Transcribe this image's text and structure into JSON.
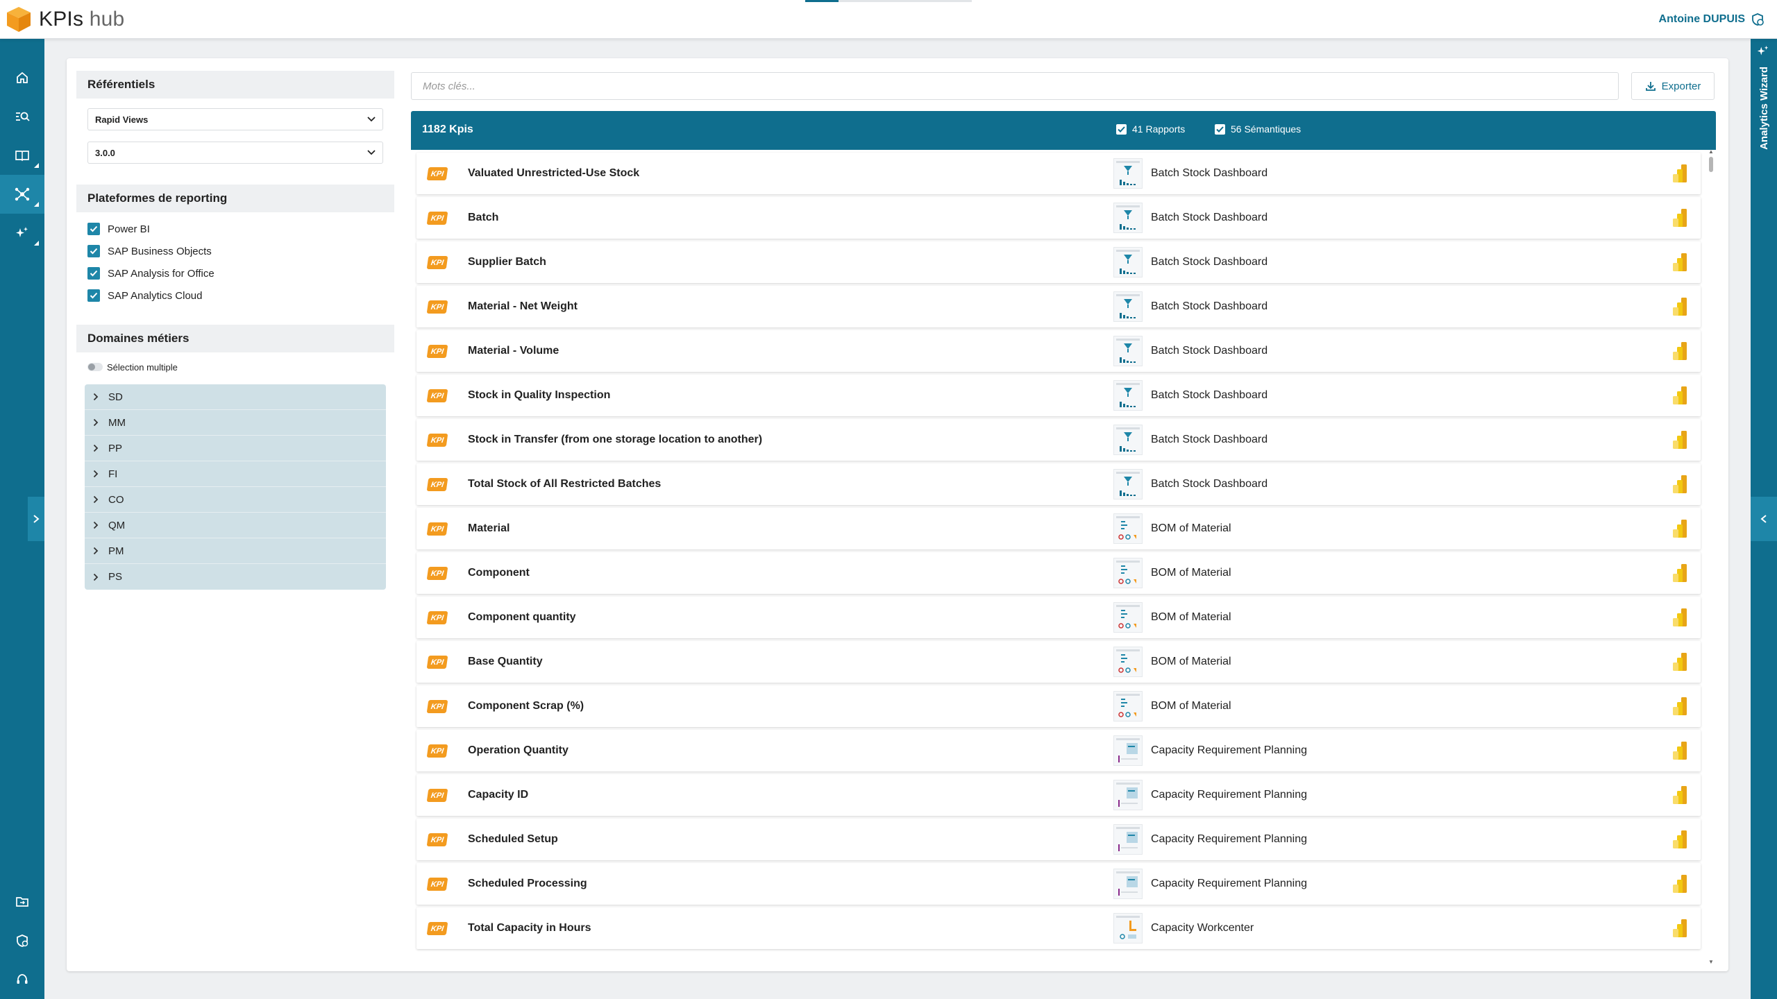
{
  "app": {
    "name_main": "KPIs",
    "name_sub": "hub"
  },
  "user": {
    "name": "Antoine DUPUIS"
  },
  "right_rail": {
    "label": "Analytics Wizard"
  },
  "filters": {
    "referentiels_title": "Référentiels",
    "referentiel_select": "Rapid Views",
    "version_select": "3.0.0",
    "plateformes_title": "Plateformes de reporting",
    "plateformes": [
      "Power BI",
      "SAP Business Objects",
      "SAP Analysis for Office",
      "SAP Analytics Cloud"
    ],
    "domaines_title": "Domaines métiers",
    "selection_multiple": "Sélection multiple",
    "domaines": [
      "SD",
      "MM",
      "PP",
      "FI",
      "CO",
      "QM",
      "PM",
      "PS"
    ]
  },
  "search": {
    "placeholder": "Mots clés..."
  },
  "export": {
    "label": "Exporter"
  },
  "list": {
    "count": "1182 Kpis",
    "rapports": "41 Rapports",
    "semantiques": "56 Sémantiques",
    "badge": "KPI",
    "rows": [
      {
        "name": "Valuated Unrestricted-Use Stock",
        "report": "Batch Stock Dashboard"
      },
      {
        "name": "Batch",
        "report": "Batch Stock Dashboard"
      },
      {
        "name": "Supplier Batch",
        "report": "Batch Stock Dashboard"
      },
      {
        "name": "Material - Net Weight",
        "report": "Batch Stock Dashboard"
      },
      {
        "name": "Material - Volume",
        "report": "Batch Stock Dashboard"
      },
      {
        "name": "Stock in Quality Inspection",
        "report": "Batch Stock Dashboard"
      },
      {
        "name": "Stock in Transfer (from one storage location to another)",
        "report": "Batch Stock Dashboard"
      },
      {
        "name": "Total Stock of All Restricted Batches",
        "report": "Batch Stock Dashboard"
      },
      {
        "name": "Material",
        "report": "BOM of Material"
      },
      {
        "name": "Component",
        "report": "BOM of Material"
      },
      {
        "name": "Component quantity",
        "report": "BOM of Material"
      },
      {
        "name": "Base Quantity",
        "report": "BOM of Material"
      },
      {
        "name": "Component Scrap (%)",
        "report": "BOM of Material"
      },
      {
        "name": "Operation Quantity",
        "report": "Capacity Requirement Planning"
      },
      {
        "name": "Capacity ID",
        "report": "Capacity Requirement Planning"
      },
      {
        "name": "Scheduled Setup",
        "report": "Capacity Requirement Planning"
      },
      {
        "name": "Scheduled Processing",
        "report": "Capacity Requirement Planning"
      },
      {
        "name": "Total Capacity in Hours",
        "report": "Capacity Workcenter"
      }
    ]
  },
  "colors": {
    "primary": "#0f6e8e",
    "accent": "#1e86a8",
    "kpi_badge": "#f39b1f",
    "powerbi": "#f2c811"
  }
}
